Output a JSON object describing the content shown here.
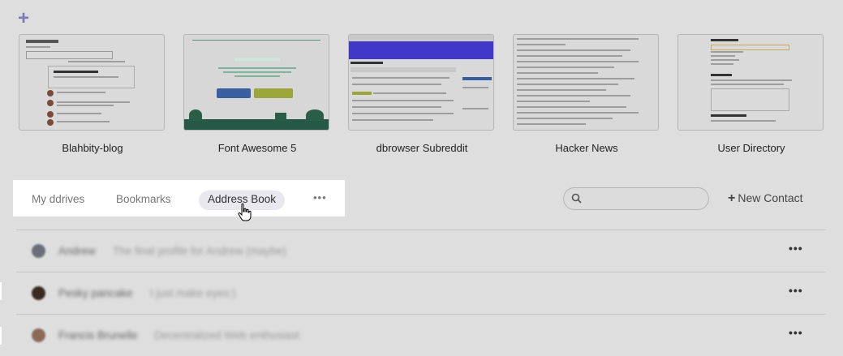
{
  "add_pin_label": "+",
  "pins": [
    {
      "title": "Blahbity-blog"
    },
    {
      "title": "Font Awesome 5"
    },
    {
      "title": "dbrowser Subreddit"
    },
    {
      "title": "Hacker News"
    },
    {
      "title": "User Directory"
    }
  ],
  "tabs": [
    {
      "label": "My ddrives"
    },
    {
      "label": "Bookmarks"
    },
    {
      "label": "Address Book"
    }
  ],
  "tabs_more": "•••",
  "search": {
    "placeholder": "",
    "value": ""
  },
  "new_contact_label": "New Contact",
  "new_contact_icon": "+",
  "contacts": [
    {
      "name": "Andrew",
      "bio": "The final profile for Andrew (maybe)",
      "avatar_color": "#6a6f7a"
    },
    {
      "name": "Pesky pancake",
      "bio": "I just make eyes:)",
      "avatar_color": "#3a2a24"
    },
    {
      "name": "Francis Brunelle",
      "bio": "Decentralized Web enthusiast",
      "avatar_color": "#8c6a5a"
    }
  ],
  "row_more": "•••",
  "colors": {
    "accent": "#7d79b8",
    "active_tab_bg": "#e8e8ee",
    "background": "#dedede"
  }
}
